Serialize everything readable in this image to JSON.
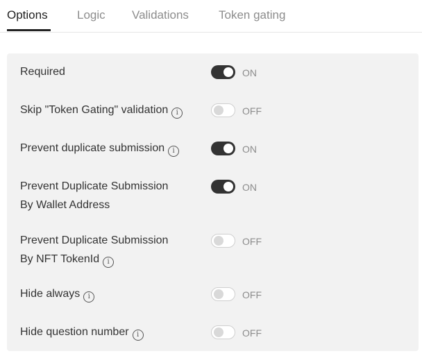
{
  "tabs": [
    {
      "label": "Options",
      "active": true
    },
    {
      "label": "Logic",
      "active": false
    },
    {
      "label": "Validations",
      "active": false
    },
    {
      "label": "Token gating",
      "active": false
    }
  ],
  "settings": [
    {
      "label": "Required",
      "info_icon": false,
      "enabled": true,
      "state_label": "ON"
    },
    {
      "label": "Skip \"Token Gating\" validation",
      "info_icon": true,
      "enabled": false,
      "state_label": "OFF"
    },
    {
      "label": "Prevent duplicate submission",
      "info_icon": true,
      "enabled": true,
      "state_label": "ON"
    },
    {
      "label_line1": "Prevent Duplicate Submission",
      "label_line2": "By Wallet Address",
      "info_icon": false,
      "enabled": true,
      "state_label": "ON"
    },
    {
      "label_line1": "Prevent Duplicate Submission",
      "label_line2": "By NFT TokenId",
      "info_icon": true,
      "enabled": false,
      "state_label": "OFF"
    },
    {
      "label": "Hide always",
      "info_icon": true,
      "enabled": false,
      "state_label": "OFF"
    },
    {
      "label": "Hide question number",
      "info_icon": true,
      "enabled": false,
      "state_label": "OFF"
    }
  ],
  "icons": {
    "info": "info-circle-icon",
    "info_glyph": "i"
  },
  "colors": {
    "toggle_on": "#333333",
    "toggle_off_knob": "#d9d9d9",
    "panel_bg": "#f2f2f2",
    "muted_text": "#8c8c8c"
  }
}
